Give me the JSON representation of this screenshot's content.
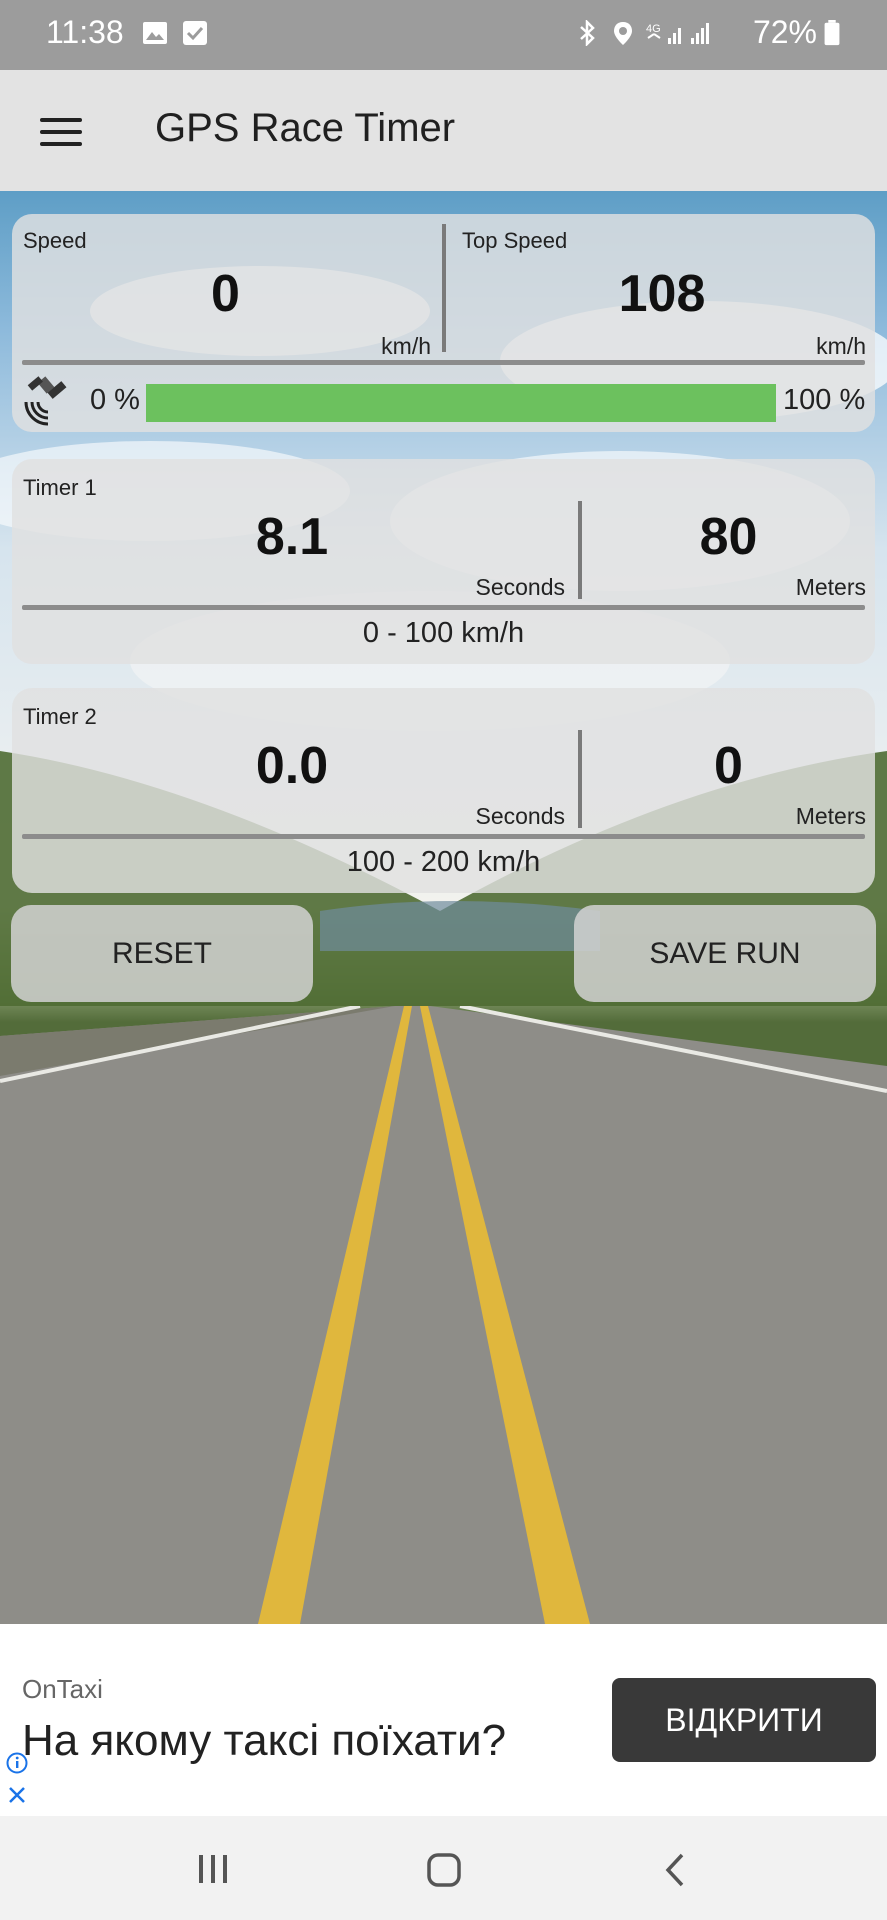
{
  "status_bar": {
    "time": "11:38",
    "battery": "72%"
  },
  "app_bar": {
    "title": "GPS Race Timer"
  },
  "speed_card": {
    "speed_label": "Speed",
    "speed_value": "0",
    "speed_unit": "km/h",
    "top_label": "Top Speed",
    "top_value": "108",
    "top_unit": "km/h",
    "gps_min": "0 %",
    "gps_max": "100 %",
    "gps_fill": 1.0
  },
  "timer1": {
    "label": "Timer 1",
    "time_value": "8.1",
    "time_unit": "Seconds",
    "dist_value": "80",
    "dist_unit": "Meters",
    "range": "0 - 100 km/h"
  },
  "timer2": {
    "label": "Timer 2",
    "time_value": "0.0",
    "time_unit": "Seconds",
    "dist_value": "0",
    "dist_unit": "Meters",
    "range": "100 - 200 km/h"
  },
  "buttons": {
    "reset": "RESET",
    "save": "SAVE RUN"
  },
  "ad": {
    "brand": "OnTaxi",
    "headline": "На якому таксі поїхати?",
    "cta": "ВІДКРИТИ"
  },
  "colors": {
    "progress": "#6cc15e",
    "accent_info": "#1a73e8"
  },
  "icons": [
    "menu-icon",
    "satellite-icon",
    "image-icon",
    "check-icon",
    "bluetooth-icon",
    "location-icon",
    "signal-icon",
    "battery-icon",
    "recents-icon",
    "home-icon",
    "back-icon",
    "info-icon",
    "close-icon"
  ]
}
